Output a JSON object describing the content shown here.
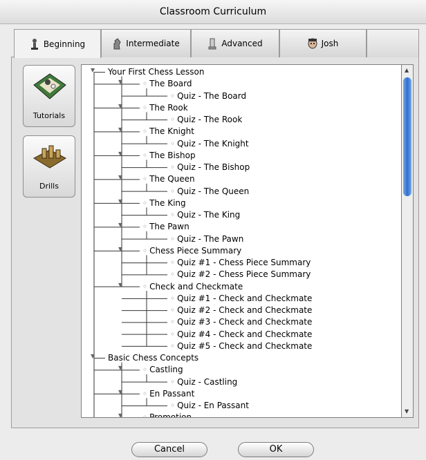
{
  "window": {
    "title": "Classroom Curriculum"
  },
  "tabs": [
    {
      "label": "Beginning",
      "icon": "pawn-piece-icon",
      "active": true
    },
    {
      "label": "Intermediate",
      "icon": "knight-piece-icon",
      "active": false
    },
    {
      "label": "Advanced",
      "icon": "rook-piece-icon",
      "active": false
    },
    {
      "label": "Josh",
      "icon": "josh-face-icon",
      "active": false
    }
  ],
  "sidebar": {
    "items": [
      {
        "label": "Tutorials",
        "icon": "chessboard-icon"
      },
      {
        "label": "Drills",
        "icon": "chess-pieces-icon"
      }
    ]
  },
  "tree": {
    "rows": [
      {
        "text": "Your First Chess Lesson",
        "level": 0,
        "expander": true
      },
      {
        "text": "The Board",
        "level": 1,
        "expander": true
      },
      {
        "text": "Quiz - The Board",
        "level": 2
      },
      {
        "text": "The Rook",
        "level": 1,
        "expander": true
      },
      {
        "text": "Quiz - The Rook",
        "level": 2
      },
      {
        "text": "The Knight",
        "level": 1,
        "expander": true
      },
      {
        "text": "Quiz - The Knight",
        "level": 2
      },
      {
        "text": "The Bishop",
        "level": 1,
        "expander": true
      },
      {
        "text": "Quiz - The Bishop",
        "level": 2
      },
      {
        "text": "The Queen",
        "level": 1,
        "expander": true
      },
      {
        "text": "Quiz - The Queen",
        "level": 2
      },
      {
        "text": "The King",
        "level": 1,
        "expander": true
      },
      {
        "text": "Quiz - The King",
        "level": 2
      },
      {
        "text": "The Pawn",
        "level": 1,
        "expander": true
      },
      {
        "text": "Quiz - The Pawn",
        "level": 2
      },
      {
        "text": "Chess Piece Summary",
        "level": 1,
        "expander": true
      },
      {
        "text": "Quiz #1 - Chess Piece Summary",
        "level": 2
      },
      {
        "text": "Quiz #2 - Chess Piece Summary",
        "level": 2
      },
      {
        "text": "Check and Checkmate",
        "level": 1,
        "expander": true
      },
      {
        "text": "Quiz #1 - Check and Checkmate",
        "level": 2
      },
      {
        "text": "Quiz #2 - Check and Checkmate",
        "level": 2
      },
      {
        "text": "Quiz #3 - Check and Checkmate",
        "level": 2
      },
      {
        "text": "Quiz #4 - Check and Checkmate",
        "level": 2
      },
      {
        "text": "Quiz #5 - Check and Checkmate",
        "level": 2
      },
      {
        "text": "Basic Chess Concepts",
        "level": 0,
        "expander": true
      },
      {
        "text": "Castling",
        "level": 1,
        "expander": true
      },
      {
        "text": "Quiz - Castling",
        "level": 2
      },
      {
        "text": "En Passant",
        "level": 1,
        "expander": true
      },
      {
        "text": "Quiz - En Passant",
        "level": 2
      },
      {
        "text": "Promotion",
        "level": 1,
        "expander": true
      }
    ]
  },
  "buttons": {
    "cancel": "Cancel",
    "ok": "OK"
  }
}
